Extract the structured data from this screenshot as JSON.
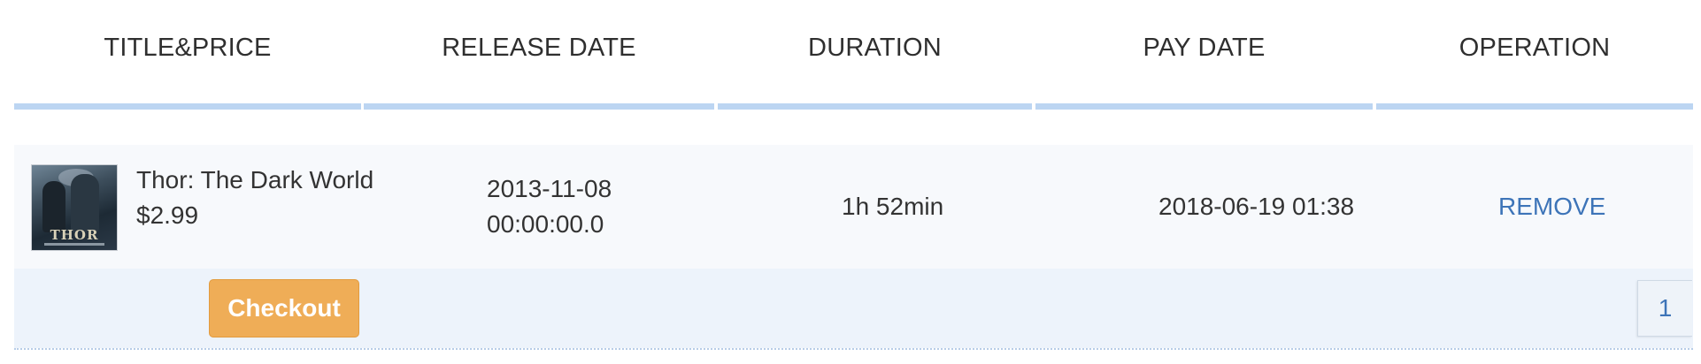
{
  "table": {
    "headers": [
      "TITLE&PRICE",
      "RELEASE DATE",
      "DURATION",
      "PAY DATE",
      "OPERATION"
    ],
    "rows": [
      {
        "title": "Thor: The Dark World",
        "price": "$2.99",
        "poster_text": "THOR",
        "release_date_line1": "2013-11-08",
        "release_date_line2": "00:00:00.0",
        "duration": "1h 52min",
        "pay_date": "2018-06-19 01:38",
        "operation": "REMOVE"
      }
    ]
  },
  "footer": {
    "checkout_label": "Checkout",
    "pagination": {
      "current_page": "1"
    }
  },
  "colors": {
    "accent_link": "#3d74b8",
    "checkout_button": "#efad57",
    "header_bar": "#bcd5f2"
  }
}
